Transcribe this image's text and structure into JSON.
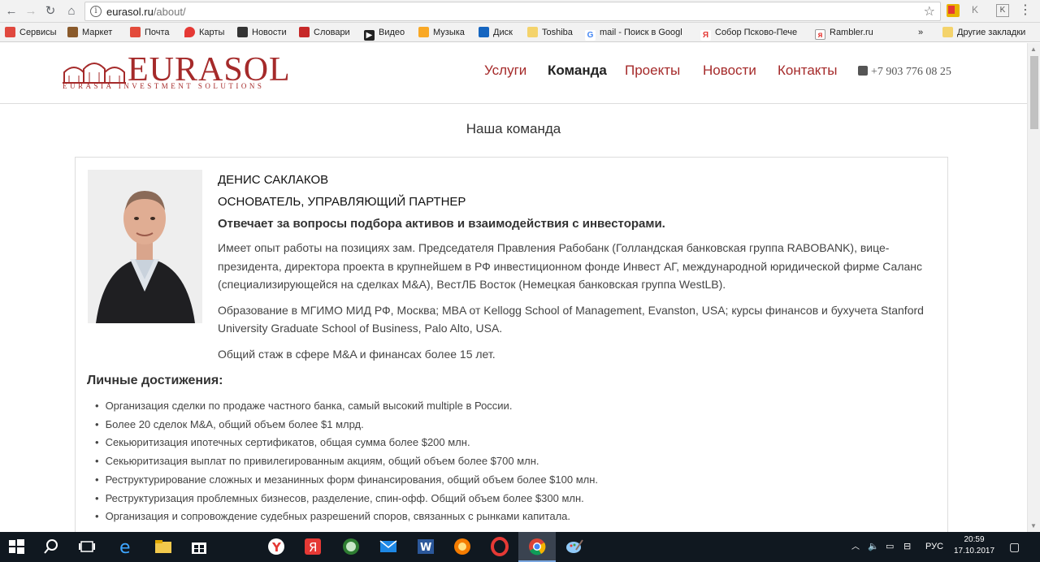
{
  "browser": {
    "url_host": "eurasol.ru",
    "url_path": "/about/",
    "bookmarks": [
      {
        "label": "Сервисы",
        "color": "#e0483e"
      },
      {
        "label": "Маркет",
        "color": "#8a5a2b"
      },
      {
        "label": "Почта",
        "color": "#e34b3b"
      },
      {
        "label": "Карты",
        "color": "#e53935"
      },
      {
        "label": "Новости",
        "color": "#333333"
      },
      {
        "label": "Словари",
        "color": "#c62828"
      },
      {
        "label": "Видео",
        "color": "#222222"
      },
      {
        "label": "Музыка",
        "color": "#f9a825"
      },
      {
        "label": "Диск",
        "color": "#1565c0"
      },
      {
        "label": "Toshiba",
        "color": "#f4d36b"
      },
      {
        "label": "mail - Поиск в Googl",
        "color": "#4285f4"
      },
      {
        "label": "Собор Псково-Пече",
        "color": "#e53935"
      },
      {
        "label": "Rambler.ru",
        "color": "#e53935"
      }
    ],
    "more": "»",
    "other_bookmarks": "Другие закладки"
  },
  "site": {
    "logo_word": "EURASOL",
    "logo_tag": "EURASIA INVESTMENT SOLUTIONS",
    "brand_color": "#a52a2a",
    "menu": [
      {
        "label": "Услуги",
        "active": false
      },
      {
        "label": "Команда",
        "active": true
      },
      {
        "label": "Проекты",
        "active": false
      },
      {
        "label": "Новости",
        "active": false
      },
      {
        "label": "Контакты",
        "active": false
      }
    ],
    "phone": "+7 903 776 08 25"
  },
  "main": {
    "section_title": "Наша команда",
    "person": {
      "name": "ДЕНИС САКЛАКОВ",
      "role": "ОСНОВАТЕЛЬ, УПРАВЛЯЮЩИЙ ПАРТНЕР",
      "responsibility": "Отвечает за вопросы подбора активов и взаимодействия с инвесторами.",
      "paragraphs": [
        "Имеет опыт работы на позициях зам. Председателя Правления Рабобанк (Голландская банковская группа RABOBANK), вице-президента, директора проекта в крупнейшем в РФ инвестиционном фонде Инвест АГ, международной юридической фирме Саланс (специализирующейся на сделках M&A), ВестЛБ Восток (Немецкая банковская группа WestLB).",
        "Образование в МГИМО МИД РФ, Москва; MBA от Kellogg School of Management, Evanston, USA; курсы финансов и бухучета Stanford University Graduate School of Business, Palo Alto, USA.",
        "Общий стаж в сфере M&A и финансах более 15 лет."
      ],
      "achievements_title": "Личные достижения:",
      "achievements": [
        "Организация сделки по продаже частного банка, самый высокий multiple в России.",
        "Более 20 сделок M&A, общий объем более $1 млрд.",
        "Секьюритизация ипотечных сертификатов, общая сумма более $200 млн.",
        "Секьюритизация выплат по привилегированным акциям, общий объем более $700 млн.",
        "Реструктурирование сложных и мезанинных форм финансирования, общий объем более $100 млн.",
        "Реструктуризация проблемных бизнесов, разделение, спин-офф. Общий объем более $300 млн.",
        "Организация и сопровождение судебных разрешений споров, связанных с рынками капитала."
      ]
    }
  },
  "taskbar": {
    "lang": "РУС",
    "time": "20:59",
    "date": "17.10.2017"
  }
}
